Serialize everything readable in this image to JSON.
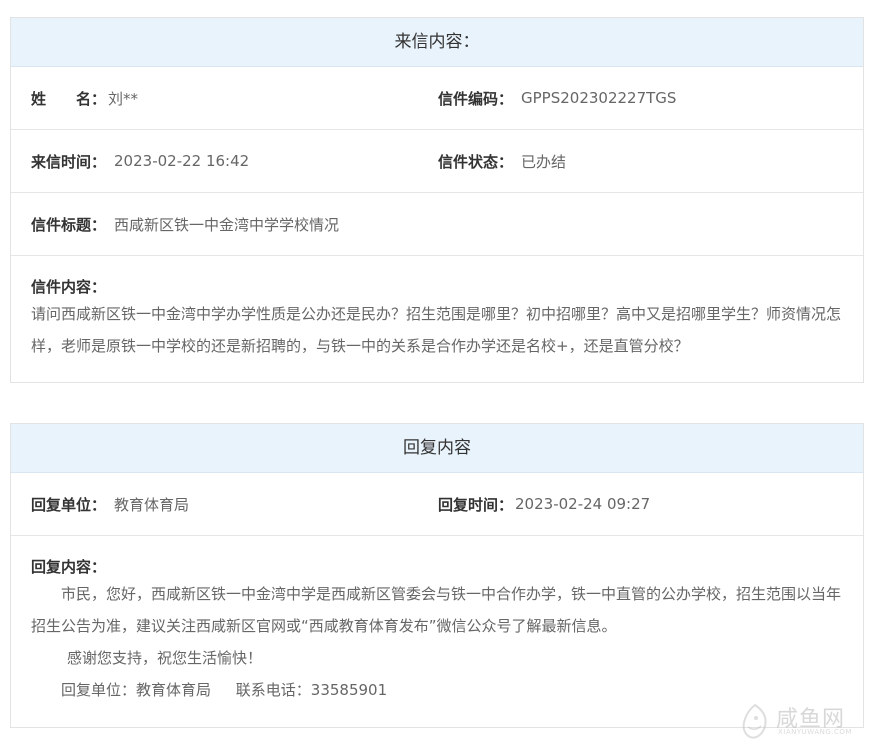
{
  "letter": {
    "header": "来信内容：",
    "name_label": "姓　　名：",
    "name_value": "刘**",
    "code_label": "信件编码：",
    "code_value": "GPPS202302227TGS",
    "time_label": "来信时间：",
    "time_value": "2023-02-22 16:42",
    "status_label": "信件状态：",
    "status_value": "已办结",
    "title_label": "信件标题：",
    "title_value": "西咸新区铁一中金湾中学学校情况",
    "content_label": "信件内容：",
    "content_value": "请问西咸新区铁一中金湾中学办学性质是公办还是民办？招生范围是哪里？初中招哪里？高中又是招哪里学生？师资情况怎样，老师是原铁一中学校的还是新招聘的，与铁一中的关系是合作办学还是名校+，还是直管分校？"
  },
  "reply": {
    "header": "回复内容",
    "unit_label": "回复单位：",
    "unit_value": "教育体育局",
    "time_label": "回复时间：",
    "time_value": "2023-02-24 09:27",
    "content_label": "回复内容：",
    "paragraph1": "市民，您好，西咸新区铁一中金湾中学是西咸新区管委会与铁一中合作办学，铁一中直管的公办学校，招生范围以当年招生公告为准，建议关注西咸新区官网或“西咸教育体育发布”微信公众号了解最新信息。",
    "paragraph2": "感谢您支持，祝您生活愉快！",
    "sign_unit": "回复单位：教育体育局",
    "sign_phone": "联系电话：33585901"
  },
  "watermark": {
    "text": "咸鱼网",
    "sub": "XIANYUWANG.COM",
    "icon": "fish-logo-icon"
  }
}
